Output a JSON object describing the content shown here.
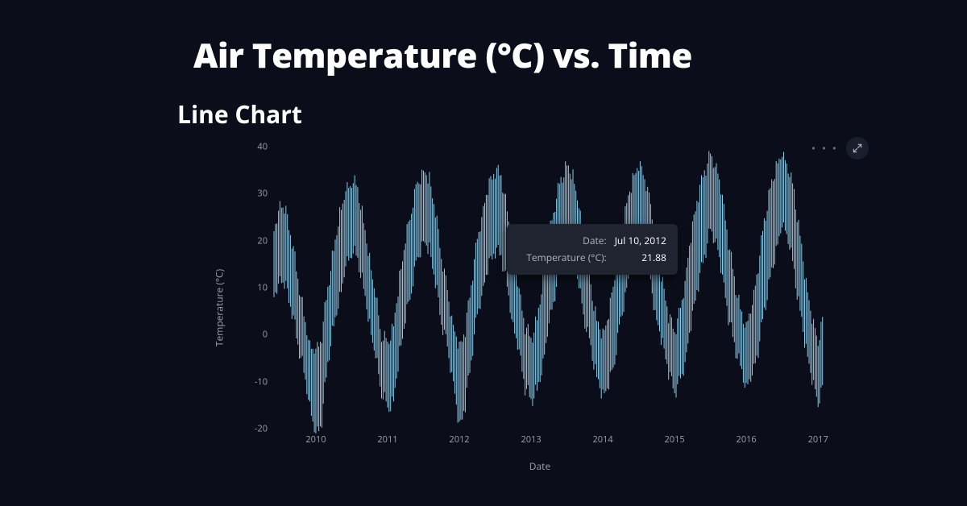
{
  "page_title": "Air Temperature (°C) vs. Time",
  "section_title": "Line Chart",
  "toolbar": {
    "more_label": "• • •",
    "expand_label": "Expand"
  },
  "tooltip": {
    "date_label": "Date:",
    "date_value": "Jul 10, 2012",
    "temp_label": "Temperature (°C):",
    "temp_value": "21.88"
  },
  "chart_data": {
    "type": "line",
    "title": "Air Temperature (°C) vs. Time",
    "xlabel": "Date",
    "ylabel": "Temperature (°C)",
    "ylim": [
      -20,
      40
    ],
    "y_ticks": [
      -20,
      -10,
      0,
      10,
      20,
      30,
      40
    ],
    "x_ticks": [
      "2010",
      "2011",
      "2012",
      "2013",
      "2014",
      "2015",
      "2016",
      "2017"
    ],
    "x_range": [
      "2009-06",
      "2017-03"
    ],
    "line_color": "#95d3f0",
    "series": [
      {
        "name": "Temperature (°C)",
        "x_monthly": [
          "2009-06",
          "2009-07",
          "2009-08",
          "2009-09",
          "2009-10",
          "2009-11",
          "2009-12",
          "2010-01",
          "2010-02",
          "2010-03",
          "2010-04",
          "2010-05",
          "2010-06",
          "2010-07",
          "2010-08",
          "2010-09",
          "2010-10",
          "2010-11",
          "2010-12",
          "2011-01",
          "2011-02",
          "2011-03",
          "2011-04",
          "2011-05",
          "2011-06",
          "2011-07",
          "2011-08",
          "2011-09",
          "2011-10",
          "2011-11",
          "2011-12",
          "2012-01",
          "2012-02",
          "2012-03",
          "2012-04",
          "2012-05",
          "2012-06",
          "2012-07",
          "2012-08",
          "2012-09",
          "2012-10",
          "2012-11",
          "2012-12",
          "2013-01",
          "2013-02",
          "2013-03",
          "2013-04",
          "2013-05",
          "2013-06",
          "2013-07",
          "2013-08",
          "2013-09",
          "2013-10",
          "2013-11",
          "2013-12",
          "2014-01",
          "2014-02",
          "2014-03",
          "2014-04",
          "2014-05",
          "2014-06",
          "2014-07",
          "2014-08",
          "2014-09",
          "2014-10",
          "2014-11",
          "2014-12",
          "2015-01",
          "2015-02",
          "2015-03",
          "2015-04",
          "2015-05",
          "2015-06",
          "2015-07",
          "2015-08",
          "2015-09",
          "2015-10",
          "2015-11",
          "2015-12",
          "2016-01",
          "2016-02",
          "2016-03",
          "2016-04",
          "2016-05",
          "2016-06",
          "2016-07",
          "2016-08",
          "2016-09",
          "2016-10",
          "2016-11",
          "2016-12",
          "2017-01",
          "2017-02"
        ],
        "monthly_min": [
          8,
          12,
          10,
          5,
          -2,
          -8,
          -15,
          -22,
          -18,
          -6,
          2,
          8,
          14,
          18,
          16,
          10,
          2,
          -5,
          -12,
          -16,
          -14,
          -4,
          3,
          10,
          16,
          20,
          18,
          11,
          3,
          -3,
          -10,
          -20,
          -15,
          -5,
          4,
          10,
          15,
          18,
          17,
          10,
          2,
          -4,
          -11,
          -14,
          -12,
          -6,
          2,
          9,
          15,
          19,
          18,
          10,
          3,
          -3,
          -9,
          -13,
          -11,
          -5,
          3,
          10,
          16,
          20,
          18,
          11,
          3,
          -2,
          -8,
          -12,
          -10,
          -4,
          4,
          11,
          17,
          22,
          20,
          12,
          4,
          -2,
          -7,
          -11,
          -9,
          -3,
          5,
          12,
          18,
          23,
          21,
          13,
          5,
          -3,
          -10,
          -14,
          -11
        ],
        "monthly_max": [
          22,
          28,
          26,
          20,
          12,
          4,
          -2,
          -4,
          0,
          10,
          18,
          26,
          30,
          33,
          31,
          24,
          16,
          8,
          0,
          -2,
          2,
          12,
          20,
          27,
          32,
          35,
          33,
          26,
          17,
          9,
          2,
          -3,
          1,
          11,
          20,
          27,
          32,
          35,
          34,
          26,
          17,
          9,
          2,
          -1,
          3,
          12,
          21,
          28,
          33,
          36,
          34,
          27,
          18,
          10,
          3,
          0,
          4,
          13,
          22,
          28,
          33,
          36,
          34,
          27,
          18,
          11,
          4,
          1,
          5,
          14,
          23,
          30,
          35,
          38,
          36,
          29,
          20,
          12,
          5,
          2,
          6,
          15,
          24,
          31,
          36,
          38,
          36,
          30,
          21,
          11,
          3,
          -1,
          4
        ],
        "monthly_mean": [
          15,
          20,
          18,
          12,
          5,
          -2,
          -8,
          -13,
          -9,
          2,
          10,
          17,
          22,
          26,
          24,
          17,
          9,
          2,
          -6,
          -9,
          -6,
          4,
          12,
          19,
          24,
          28,
          26,
          18,
          10,
          3,
          -4,
          -11,
          -7,
          3,
          12,
          19,
          24,
          27,
          26,
          18,
          10,
          3,
          -4,
          -7,
          -4,
          3,
          12,
          19,
          24,
          28,
          26,
          19,
          11,
          4,
          -3,
          -6,
          -3,
          4,
          13,
          19,
          25,
          28,
          26,
          19,
          11,
          5,
          -2,
          -5,
          -2,
          5,
          14,
          21,
          26,
          30,
          28,
          21,
          12,
          5,
          -1,
          -4,
          -1,
          6,
          15,
          22,
          27,
          31,
          29,
          22,
          13,
          4,
          -3,
          -7,
          -3
        ]
      }
    ],
    "hover_point": {
      "x": "2012-07-10",
      "y": 21.88
    }
  }
}
